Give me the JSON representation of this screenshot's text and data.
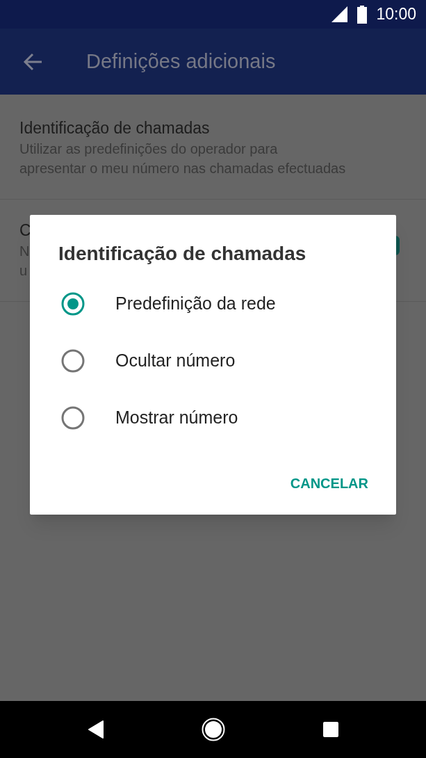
{
  "status_bar": {
    "time": "10:00"
  },
  "app_bar": {
    "title": "Definições adicionais"
  },
  "settings": [
    {
      "title": "Identificação de chamadas",
      "summary": [
        "Utilizar as predefinições do operador para",
        "apresentar o meu número nas chamadas efectuadas"
      ]
    },
    {
      "title": "C",
      "summary": [
        "N",
        "u"
      ],
      "switch_on": true
    }
  ],
  "dialog": {
    "title": "Identificação de chamadas",
    "options": [
      {
        "label": "Predefinição da rede",
        "selected": true
      },
      {
        "label": "Ocultar número",
        "selected": false
      },
      {
        "label": "Mostrar número",
        "selected": false
      }
    ],
    "buttons": [
      "CANCELAR"
    ]
  }
}
